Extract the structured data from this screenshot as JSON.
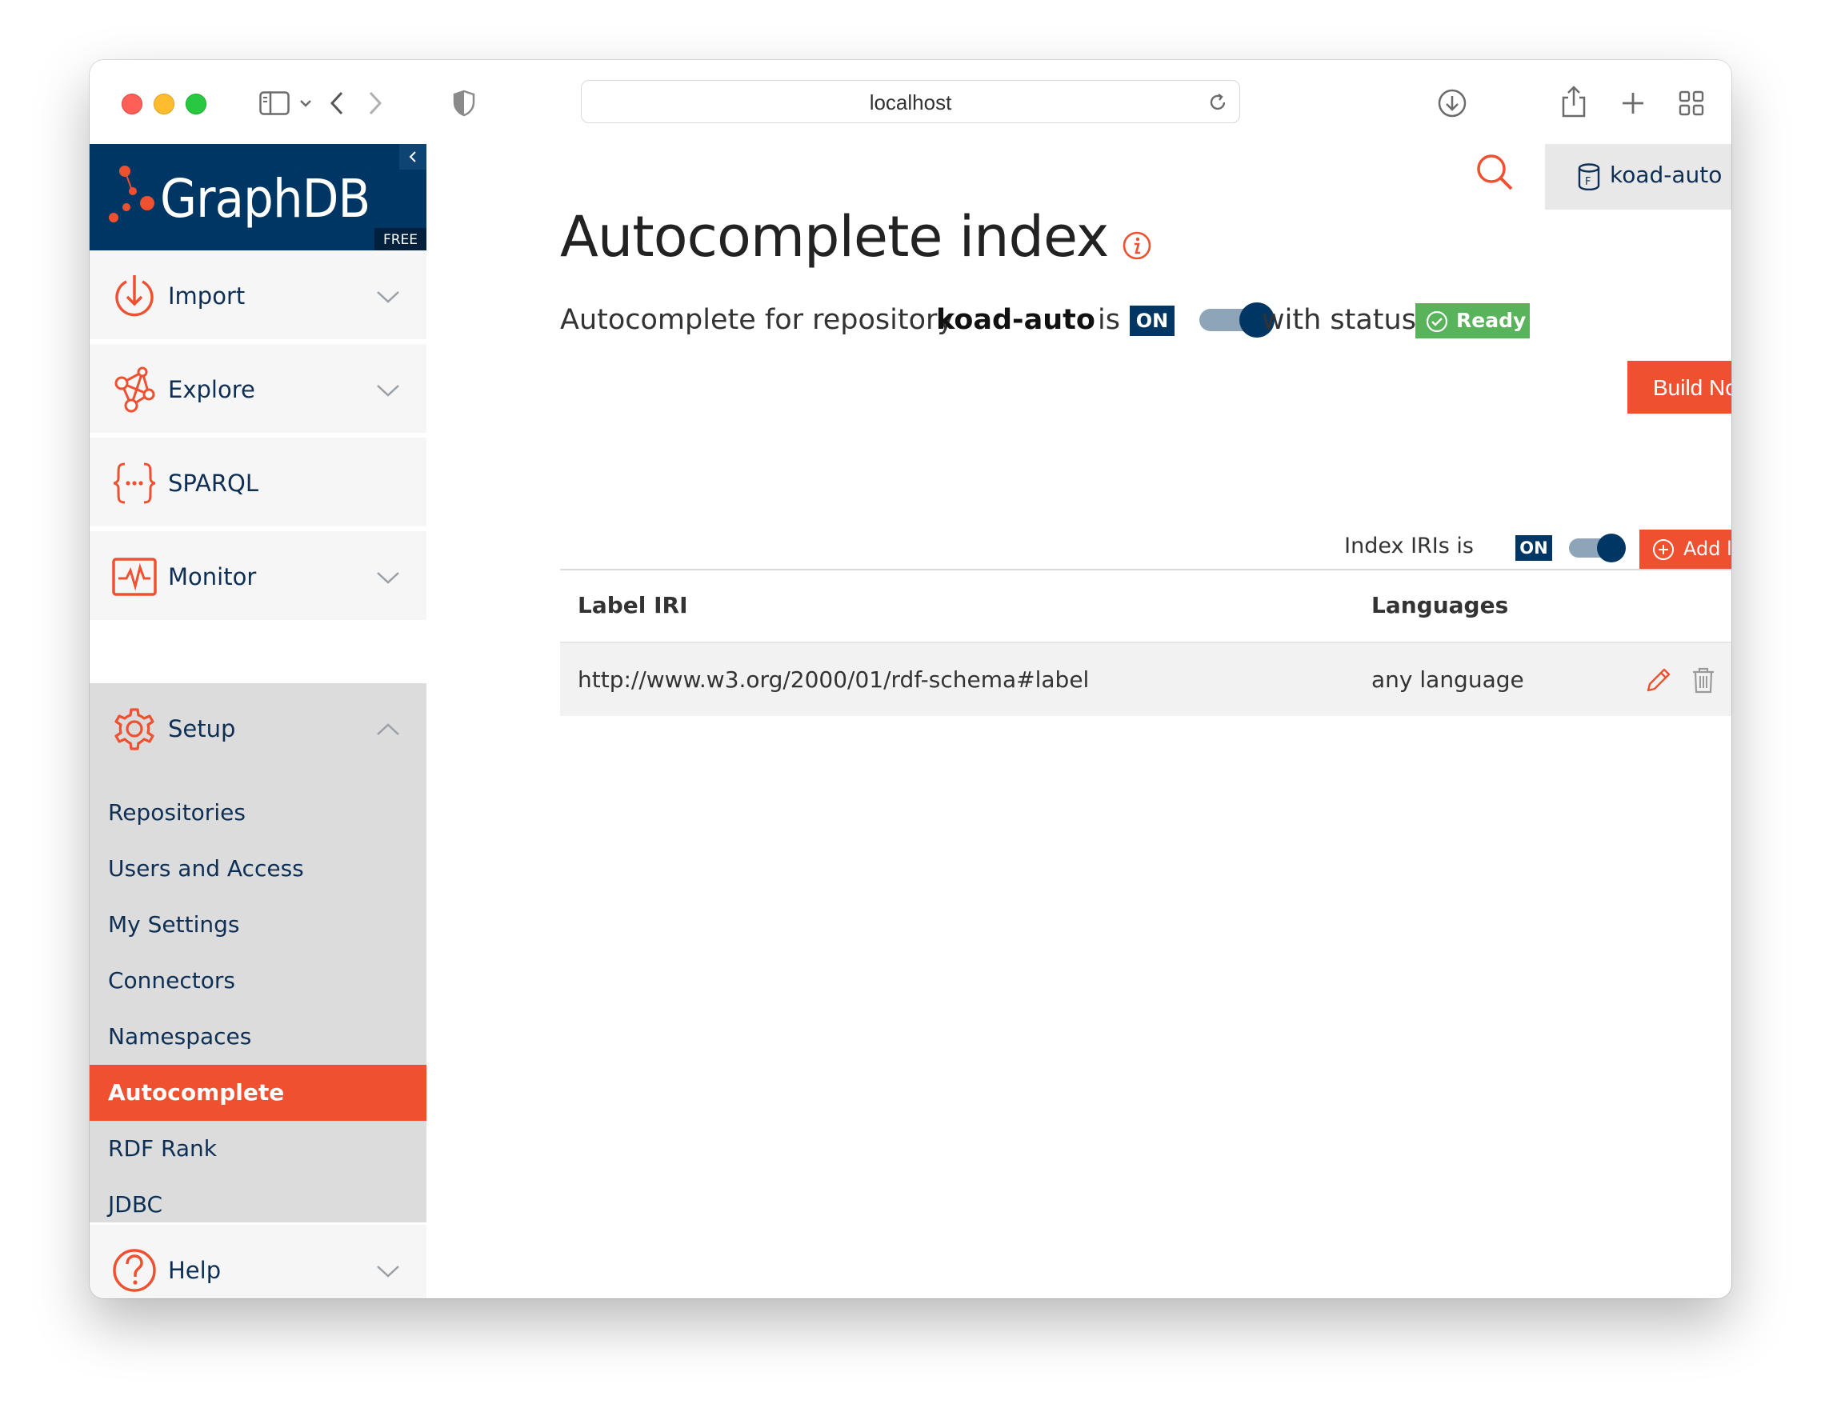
{
  "browser": {
    "url": "localhost"
  },
  "brand": {
    "name": "GraphDB",
    "edition": "FREE",
    "accent": "#ef5030",
    "navy": "#003663"
  },
  "sidebar": {
    "items": [
      {
        "label": "Import",
        "icon": "import-icon",
        "expandable": true
      },
      {
        "label": "Explore",
        "icon": "explore-icon",
        "expandable": true
      },
      {
        "label": "SPARQL",
        "icon": "sparql-icon",
        "expandable": false
      },
      {
        "label": "Monitor",
        "icon": "monitor-icon",
        "expandable": true
      },
      {
        "label": "Setup",
        "icon": "gear-icon",
        "expanded": true
      },
      {
        "label": "Help",
        "icon": "help-icon",
        "expandable": true
      }
    ],
    "setup_subitems": [
      {
        "label": "Repositories"
      },
      {
        "label": "Users and Access"
      },
      {
        "label": "My Settings"
      },
      {
        "label": "Connectors"
      },
      {
        "label": "Namespaces"
      },
      {
        "label": "Autocomplete",
        "active": true
      },
      {
        "label": "RDF Rank"
      },
      {
        "label": "JDBC"
      }
    ]
  },
  "header": {
    "repository": "koad-auto"
  },
  "page": {
    "title": "Autocomplete index",
    "status_prefix": "Autocomplete for repository",
    "repository": "koad-auto",
    "is_text": "is",
    "on_badge": "ON",
    "autocomplete_enabled": true,
    "with_status": "with status",
    "status": "Ready",
    "build_button": "Build Now",
    "index_iris_label": "Index IRIs is",
    "index_iris_badge": "ON",
    "index_iris_enabled": true,
    "add_label_button": "Add label"
  },
  "table": {
    "columns": [
      "Label IRI",
      "Languages"
    ],
    "rows": [
      {
        "iri": "http://www.w3.org/2000/01/rdf-schema#label",
        "languages": "any language"
      }
    ]
  }
}
